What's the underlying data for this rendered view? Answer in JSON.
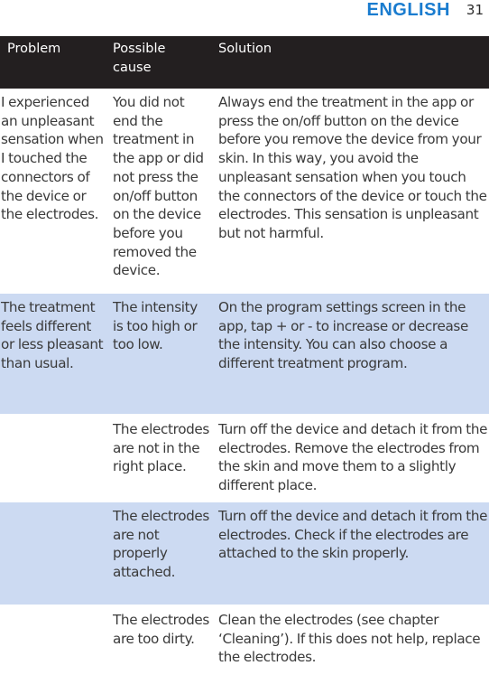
{
  "header": {
    "language": "ENGLISH",
    "page_number": "31"
  },
  "colors": {
    "language_accent": "#1a7ccf",
    "table_header_bg": "#231f20",
    "shaded_row_bg": "#ccdaf2",
    "body_text": "#3a3a3a"
  },
  "table": {
    "columns": [
      "Problem",
      "Possible cause",
      "Solution"
    ],
    "rows": [
      {
        "problem": "I experienced an unpleasant sensation when I touched the connectors of the device or the electrodes.",
        "cause": "You did not end the treatment in the app or did not press the on/off button on the device before you removed the device.",
        "solution": "Always end the treatment in the app or press the on/off button on the device before you remove the device from your skin. In this way, you avoid the unpleasant sensation when you touch the connectors of the device or touch the electrodes. This sensation is unpleasant but not harmful."
      },
      {
        "problem": "The treatment feels different or less pleasant than usual.",
        "cause": "The intensity is too high or too low.",
        "solution": "On the program settings screen in the app, tap + or - to increase or decrease the intensity. You can also choose a different treatment program."
      },
      {
        "problem": "",
        "cause": "The electrodes are not in the right place.",
        "solution": "Turn off the device and detach it from the electrodes. Remove the electrodes from the skin and move them to a slightly different place."
      },
      {
        "problem": "",
        "cause": "The electrodes are not properly attached.",
        "solution": "Turn off the device and detach it from the electrodes. Check if the electrodes are attached to the skin properly."
      },
      {
        "problem": "",
        "cause": "The electrodes are too dirty.",
        "solution": "Clean the electrodes (see chapter ‘Cleaning’). If this does not help, replace the electrodes."
      }
    ]
  }
}
